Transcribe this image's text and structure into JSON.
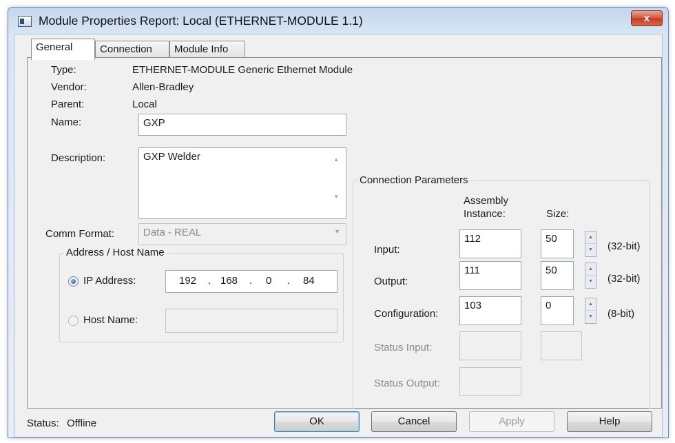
{
  "window": {
    "title": "Module Properties Report: Local (ETHERNET-MODULE 1.1)",
    "close_label": "x"
  },
  "tabs": [
    {
      "label": "General"
    },
    {
      "label": "Connection"
    },
    {
      "label": "Module Info"
    }
  ],
  "general": {
    "type_label": "Type:",
    "type_value": "ETHERNET-MODULE Generic Ethernet Module",
    "vendor_label": "Vendor:",
    "vendor_value": "Allen-Bradley",
    "parent_label": "Parent:",
    "parent_value": "Local",
    "name_label": "Name:",
    "name_value": "GXP",
    "description_label": "Description:",
    "description_value": "GXP Welder",
    "comm_format_label": "Comm Format:",
    "comm_format_value": "Data - REAL"
  },
  "address": {
    "group_title": "Address / Host Name",
    "ip_label": "IP Address:",
    "ip_octets": [
      "192",
      "168",
      "0",
      "84"
    ],
    "ip_separator": ".",
    "host_label": "Host Name:",
    "host_value": "",
    "selected": "ip"
  },
  "connection": {
    "group_title": "Connection Parameters",
    "col_instance_line1": "Assembly",
    "col_instance_line2": "Instance:",
    "col_size": "Size:",
    "rows": [
      {
        "label": "Input:",
        "instance": "112",
        "size": "50",
        "unit": "(32-bit)",
        "enabled": true
      },
      {
        "label": "Output:",
        "instance": "111",
        "size": "50",
        "unit": "(32-bit)",
        "enabled": true
      },
      {
        "label": "Configuration:",
        "instance": "103",
        "size": "0",
        "unit": "(8-bit)",
        "enabled": true
      },
      {
        "label": "Status Input:",
        "instance": "",
        "size": "",
        "enabled": false
      },
      {
        "label": "Status Output:",
        "instance": "",
        "enabled": false
      }
    ]
  },
  "footer": {
    "status_label": "Status:",
    "status_value": "Offline",
    "ok_label": "OK",
    "cancel_label": "Cancel",
    "apply_label": "Apply",
    "help_label": "Help"
  }
}
